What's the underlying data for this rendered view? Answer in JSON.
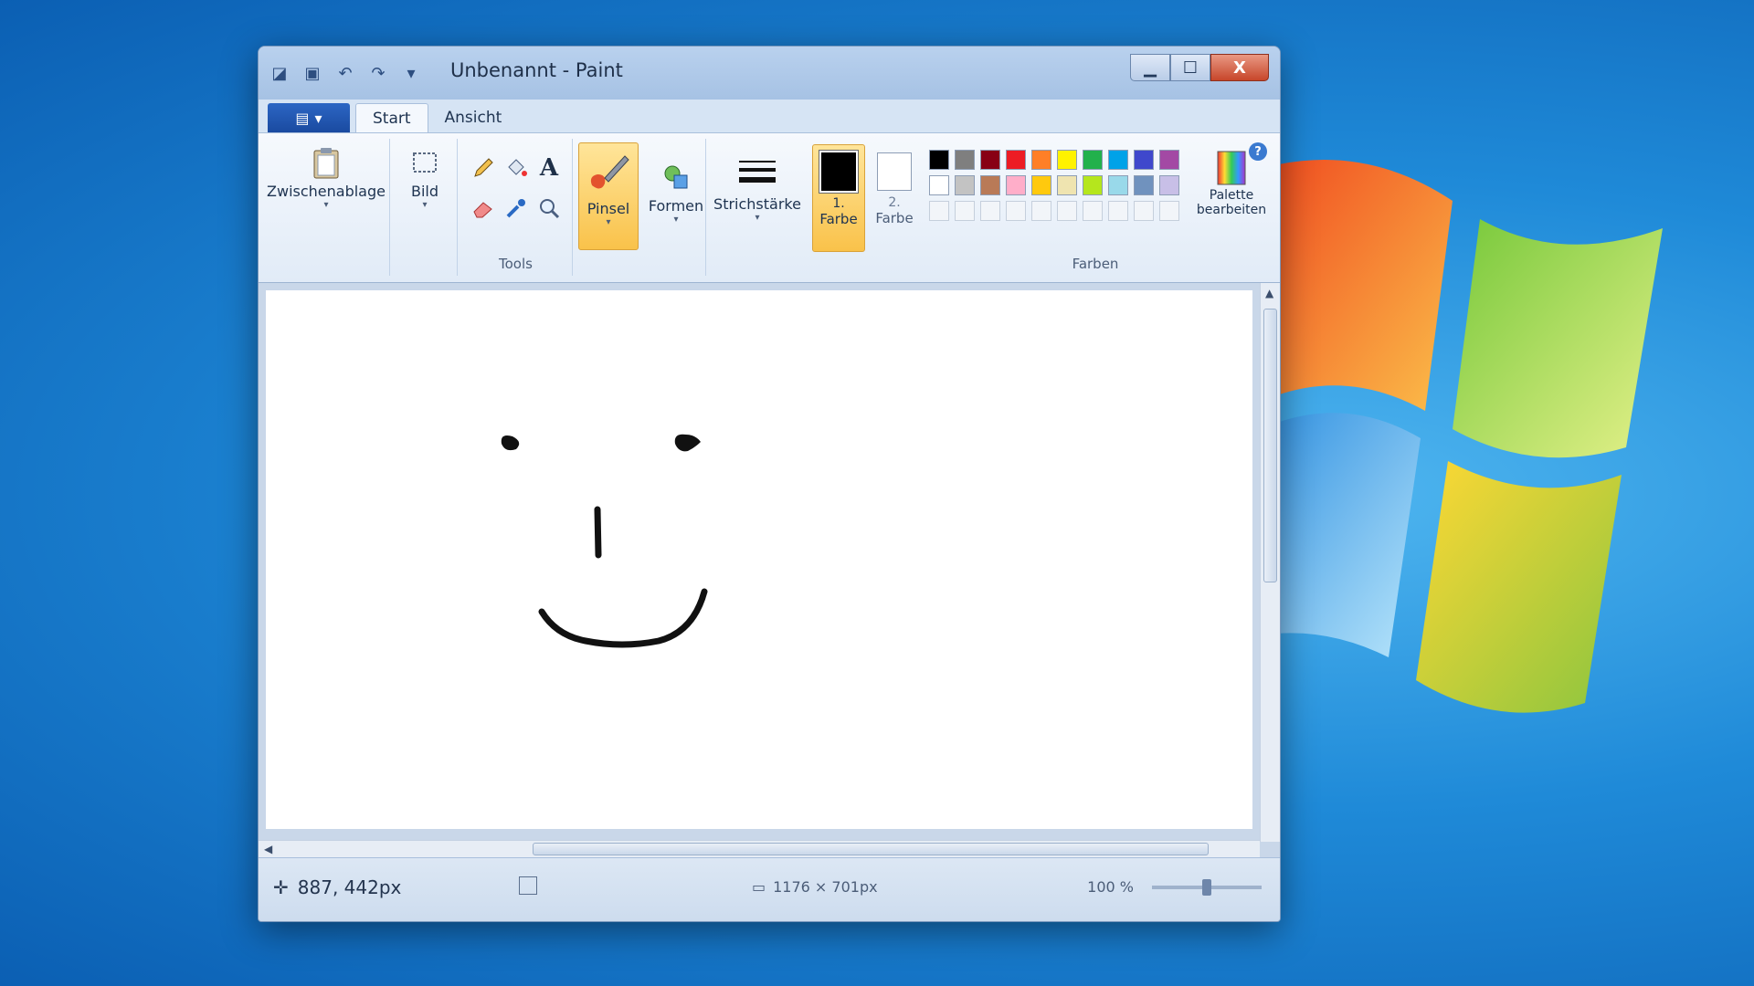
{
  "window": {
    "title": "Unbenannt - Paint",
    "controls": {
      "minimize": "▁",
      "maximize": "☐",
      "close": "X"
    }
  },
  "tabs": [
    {
      "label": "Start",
      "active": true
    },
    {
      "label": "Ansicht",
      "active": false
    }
  ],
  "ribbon": {
    "clipboard": {
      "label": "Zwischenablage",
      "icon": "clipboard-icon"
    },
    "image": {
      "label": "Bild",
      "icon": "select-icon"
    },
    "tools": {
      "group_label": "Tools",
      "items": [
        "pencil-icon",
        "fill-icon",
        "text-icon",
        "eraser-icon",
        "color-picker-icon",
        "magnifier-icon"
      ],
      "text_glyph": "A"
    },
    "brush": {
      "label": "Pinsel",
      "icon": "brush-icon"
    },
    "shapes": {
      "label": "Formen",
      "icon": "shapes-icon"
    },
    "stroke": {
      "label": "Strichstärke",
      "icon": "stroke-width-icon"
    },
    "color1": {
      "line1": "1.",
      "line2": "Farbe",
      "value": "#000000"
    },
    "color2": {
      "line1": "2.",
      "line2": "Farbe",
      "value": "#ffffff"
    },
    "colors": {
      "group_label": "Farben",
      "row1": [
        "#000000",
        "#7f7f7f",
        "#880015",
        "#ed1c24",
        "#ff7f27",
        "#fff200",
        "#22b14c",
        "#00a2e8",
        "#3f48cc",
        "#a349a4"
      ],
      "row2": [
        "#ffffff",
        "#c3c3c3",
        "#b97a57",
        "#ffaec9",
        "#ffc90e",
        "#efe4b0",
        "#b5e61d",
        "#99d9ea",
        "#7092be",
        "#c8bfe7"
      ],
      "empty_count": 10
    },
    "edit_palette": {
      "line1": "Palette",
      "line2": "bearbeiten",
      "icon": "palette-icon"
    },
    "help": "?"
  },
  "status": {
    "coords": "887, 442px",
    "size": "1176 × 701px",
    "zoom": "100 %"
  },
  "colors": {
    "stroke": "#111111",
    "accent": "#f9c24a"
  }
}
